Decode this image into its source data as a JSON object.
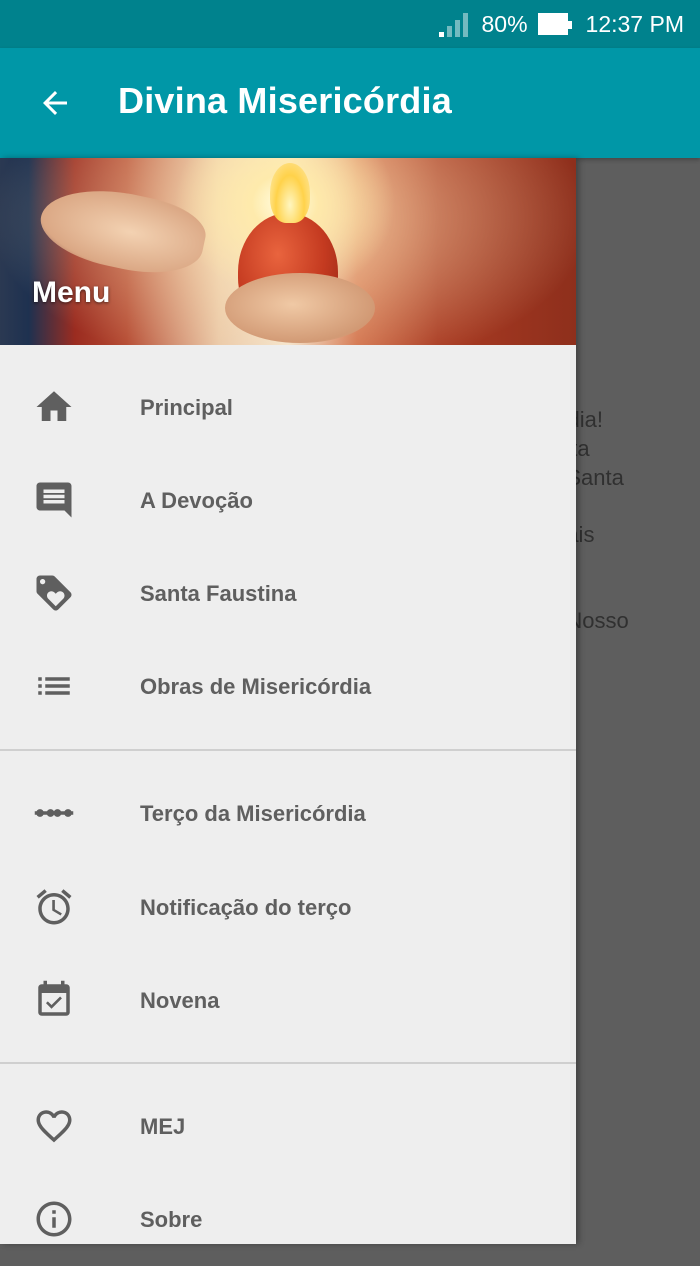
{
  "status_bar": {
    "battery_percent": "80%",
    "time": "12:37 PM"
  },
  "app_bar": {
    "title": "Divina Misericórdia"
  },
  "background_content": {
    "lines": [
      "órdia!",
      "esta",
      "à Santa",
      "mais",
      "e Nosso"
    ]
  },
  "drawer": {
    "header_label": "Menu",
    "sections": [
      {
        "items": [
          {
            "label": "Principal",
            "icon": "home-icon"
          },
          {
            "label": "A Devoção",
            "icon": "comment-icon"
          },
          {
            "label": "Santa Faustina",
            "icon": "tag-heart-icon"
          },
          {
            "label": "Obras de Misericórdia",
            "icon": "list-icon"
          }
        ]
      },
      {
        "items": [
          {
            "label": "Terço da Misericórdia",
            "icon": "beads-icon"
          },
          {
            "label": "Notificação do terço",
            "icon": "alarm-icon"
          },
          {
            "label": "Novena",
            "icon": "calendar-check-icon"
          }
        ]
      },
      {
        "items": [
          {
            "label": "MEJ",
            "icon": "heart-icon"
          },
          {
            "label": "Sobre",
            "icon": "info-icon"
          }
        ]
      }
    ]
  },
  "colors": {
    "status_bar": "#00828d",
    "app_bar": "#0097a7",
    "drawer_bg": "#eeeeee",
    "scrim": "#5e5e5e",
    "icon": "#5f5f5f"
  }
}
